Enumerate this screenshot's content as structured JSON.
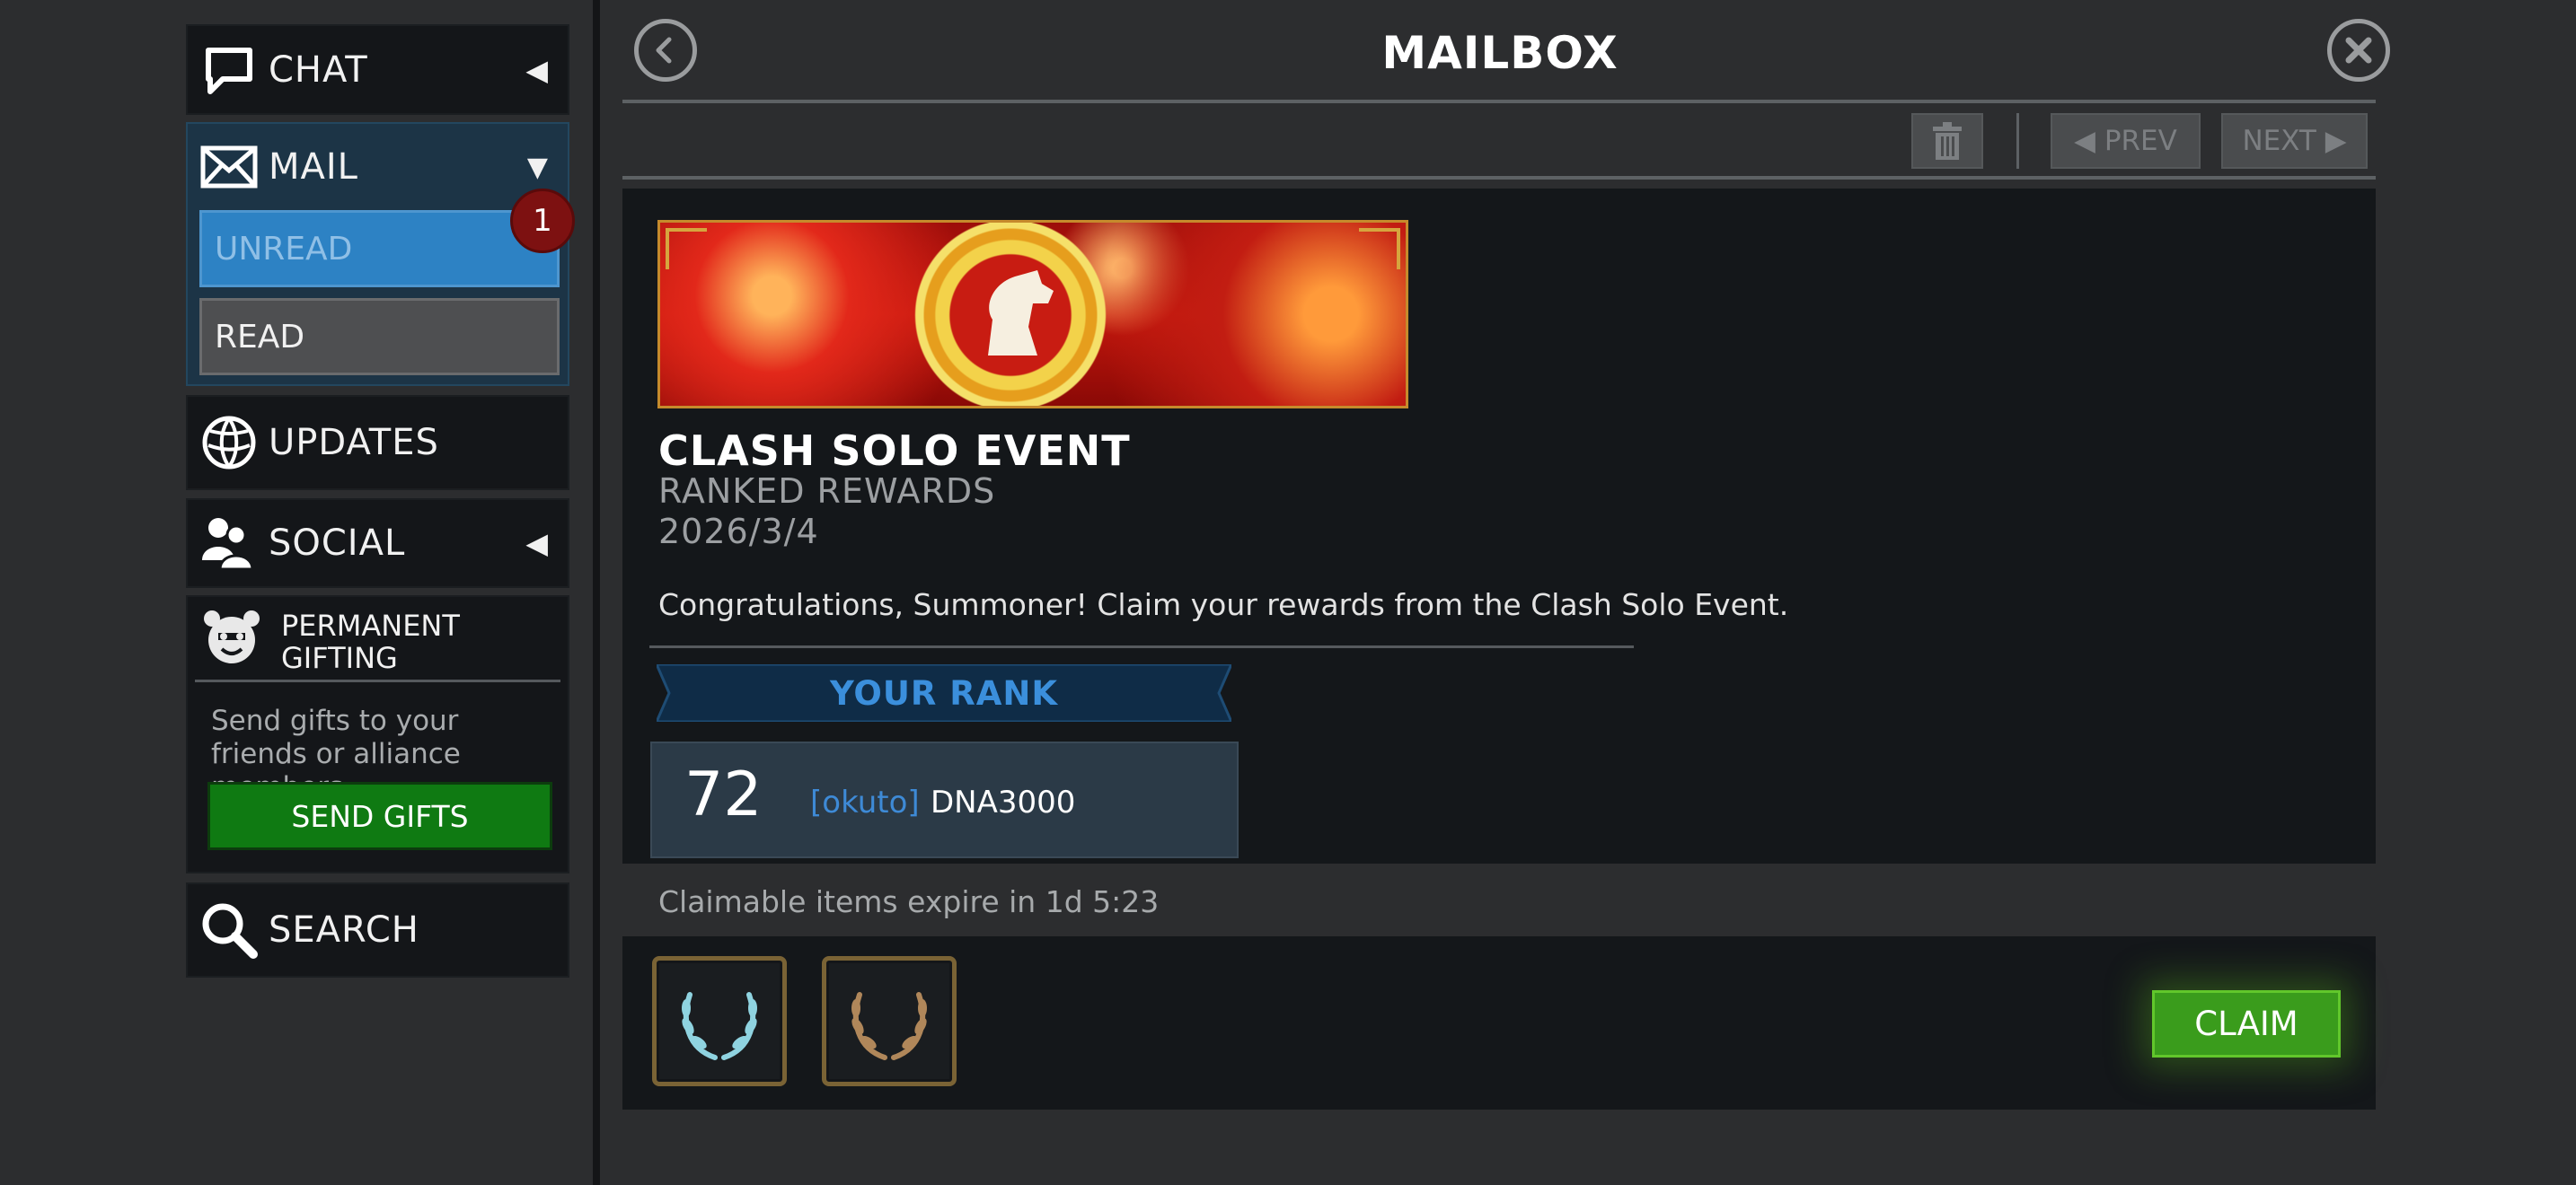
{
  "sidebar": {
    "chat": {
      "label": "CHAT",
      "icon": "speech-bubble-icon"
    },
    "mail": {
      "label": "MAIL",
      "icon": "envelope-icon",
      "unread_label": "UNREAD",
      "read_label": "READ",
      "unread_count": "1"
    },
    "updates": {
      "label": "UPDATES",
      "icon": "globe-icon"
    },
    "social": {
      "label": "SOCIAL",
      "icon": "people-icon"
    },
    "gifting": {
      "title_line1": "PERMANENT",
      "title_line2": "GIFTING",
      "description": "Send gifts to your friends or alliance members.",
      "button_label": "SEND GIFTS",
      "icon": "gift-mascot-icon"
    },
    "search": {
      "label": "SEARCH",
      "icon": "search-icon"
    }
  },
  "header": {
    "title": "MAILBOX",
    "prev_label": "◀ PREV",
    "next_label": "NEXT ▶"
  },
  "mail": {
    "title": "CLASH SOLO EVENT",
    "subtitle": "RANKED REWARDS",
    "date": "2026/3/4",
    "body": "Congratulations, Summoner! Claim your rewards from the Clash Solo Event.",
    "rank_heading": "YOUR RANK",
    "rank": {
      "number": "72",
      "alliance": "[okuto]",
      "player": "DNA3000"
    }
  },
  "rewards": {
    "expire_text": "Claimable items expire in 1d 5:23",
    "items": [
      {
        "icon": "silver-laurel-icon"
      },
      {
        "icon": "bronze-laurel-icon"
      }
    ],
    "claim_label": "CLAIM"
  },
  "colors": {
    "accent_blue": "#2d82c4",
    "claim_green": "#3a9c1c",
    "gifts_green": "#0f7a12",
    "badge_red": "#7d1111"
  }
}
